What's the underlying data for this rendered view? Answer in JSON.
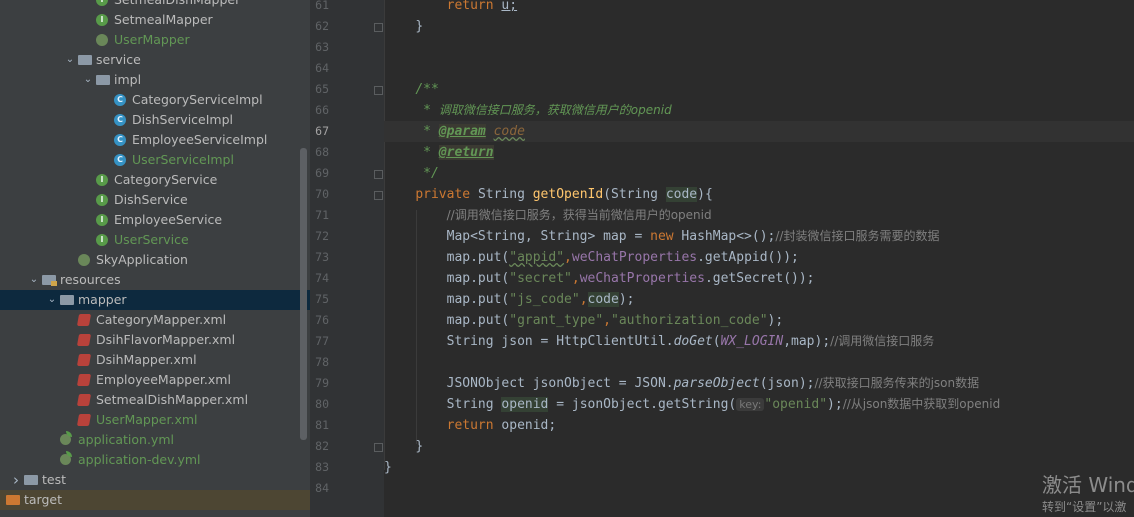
{
  "project_tree": {
    "items": [
      {
        "label": "SetmealDishMapper",
        "icon": "interface-icon",
        "color": "white",
        "depth": 5
      },
      {
        "label": "SetmealMapper",
        "icon": "interface-icon",
        "color": "white",
        "depth": 5
      },
      {
        "label": "UserMapper",
        "icon": "spring-bean-icon",
        "color": "green",
        "depth": 5
      },
      {
        "label": "service",
        "icon": "package-folder-icon",
        "color": "white",
        "depth": 4,
        "arrow": "expanded"
      },
      {
        "label": "impl",
        "icon": "package-folder-icon",
        "color": "white",
        "depth": 5,
        "arrow": "expanded"
      },
      {
        "label": "CategoryServiceImpl",
        "icon": "class-icon",
        "color": "white",
        "depth": 6
      },
      {
        "label": "DishServiceImpl",
        "icon": "class-icon",
        "color": "white",
        "depth": 6
      },
      {
        "label": "EmployeeServiceImpl",
        "icon": "class-icon",
        "color": "white",
        "depth": 6
      },
      {
        "label": "UserServiceImpl",
        "icon": "class-icon",
        "color": "green",
        "depth": 6
      },
      {
        "label": "CategoryService",
        "icon": "interface-icon",
        "color": "white",
        "depth": 5
      },
      {
        "label": "DishService",
        "icon": "interface-icon",
        "color": "white",
        "depth": 5
      },
      {
        "label": "EmployeeService",
        "icon": "interface-icon",
        "color": "white",
        "depth": 5
      },
      {
        "label": "UserService",
        "icon": "interface-icon",
        "color": "green",
        "depth": 5
      },
      {
        "label": "SkyApplication",
        "icon": "spring-app-icon",
        "color": "white",
        "depth": 4
      },
      {
        "label": "resources",
        "icon": "resources-folder-icon",
        "color": "white",
        "depth": 2,
        "arrow": "expanded"
      },
      {
        "label": "mapper",
        "icon": "folder-icon",
        "color": "white",
        "depth": 3,
        "arrow": "expanded",
        "selected": true
      },
      {
        "label": "CategoryMapper.xml",
        "icon": "mybatis-xml-icon",
        "color": "white",
        "depth": 4
      },
      {
        "label": "DsihFlavorMapper.xml",
        "icon": "mybatis-xml-icon",
        "color": "white",
        "depth": 4
      },
      {
        "label": "DsihMapper.xml",
        "icon": "mybatis-xml-icon",
        "color": "white",
        "depth": 4
      },
      {
        "label": "EmployeeMapper.xml",
        "icon": "mybatis-xml-icon",
        "color": "white",
        "depth": 4
      },
      {
        "label": "SetmealDishMapper.xml",
        "icon": "mybatis-xml-icon",
        "color": "white",
        "depth": 4
      },
      {
        "label": "UserMapper.xml",
        "icon": "mybatis-xml-icon",
        "color": "green",
        "depth": 4
      },
      {
        "label": "application.yml",
        "icon": "yaml-icon",
        "color": "green",
        "depth": 3
      },
      {
        "label": "application-dev.yml",
        "icon": "yaml-icon",
        "color": "green",
        "depth": 3
      },
      {
        "label": "test",
        "icon": "folder-icon",
        "color": "white",
        "depth": 1,
        "arrow": "collapsed"
      },
      {
        "label": "target",
        "icon": "excluded-folder-icon",
        "color": "white",
        "depth": 0,
        "arrow": "collapsed",
        "target": true
      }
    ]
  },
  "editor": {
    "line_numbers": [
      "61",
      "62",
      "63",
      "64",
      "65",
      "66",
      "67",
      "68",
      "69",
      "70",
      "71",
      "72",
      "73",
      "74",
      "75",
      "76",
      "77",
      "78",
      "79",
      "80",
      "81",
      "82",
      "83",
      "84"
    ],
    "current_line": "67",
    "lines": {
      "l61": {
        "kw": "return",
        "rest": "u;"
      },
      "l62": "}",
      "l65": "/**",
      "l66a": " * ",
      "l66b": "调取微信接口服务，获取微信用户的openid",
      "l67a": " * ",
      "l67tag": "@param",
      "l67p": "code",
      "l68a": " * ",
      "l68tag": "@return",
      "l69": " */",
      "l70": {
        "kw": "private",
        "type": "String ",
        "fn": "getOpenId",
        "open": "(String ",
        "param": "code",
        "close": "){"
      },
      "l71": "//调用微信接口服务，获得当前微信用户的openid",
      "l72": {
        "a": "Map<String, String> map = ",
        "kw": "new",
        "b": " HashMap<>();",
        "c": "//封装微信接口服务需要的数据"
      },
      "l73": {
        "a": "map.put(",
        "s": "\"appid\"",
        "comma": ",",
        "f": "weChatProperties",
        "b": ".getAppid());"
      },
      "l74": {
        "a": "map.put(",
        "s": "\"secret\"",
        "comma": ",",
        "f": "weChatProperties",
        "b": ".getSecret());"
      },
      "l75": {
        "a": "map.put(",
        "s": "\"js_code\"",
        "comma": ",",
        "p": "code",
        "b": ");"
      },
      "l76": {
        "a": "map.put(",
        "s1": "\"grant_type\"",
        "comma": ",",
        "s2": "\"authorization_code\"",
        "b": ");"
      },
      "l77": {
        "a": "String json = HttpClientUtil.",
        "m": "doGet",
        "open": "(",
        "c": "WX_LOGIN",
        "mid": ",map);",
        "cmt": "//调用微信接口服务"
      },
      "l79": {
        "a": "JSONObject jsonObject = JSON.",
        "m": "parseObject",
        "b": "(json);",
        "cmt": "//获取接口服务传来的json数据"
      },
      "l80": {
        "a": "String ",
        "v": "openid",
        "b": " = jsonObject.getString(",
        "hint": "key:",
        "s": "\"openid\"",
        "c": ");",
        "cmt": "//从json数据中获取到openid"
      },
      "l81": {
        "kw": "return",
        "rest": " openid;"
      },
      "l82": "}",
      "l83": "}"
    }
  },
  "watermark": {
    "line1": "激活 Wind",
    "line2": "转到“设置”以激"
  }
}
